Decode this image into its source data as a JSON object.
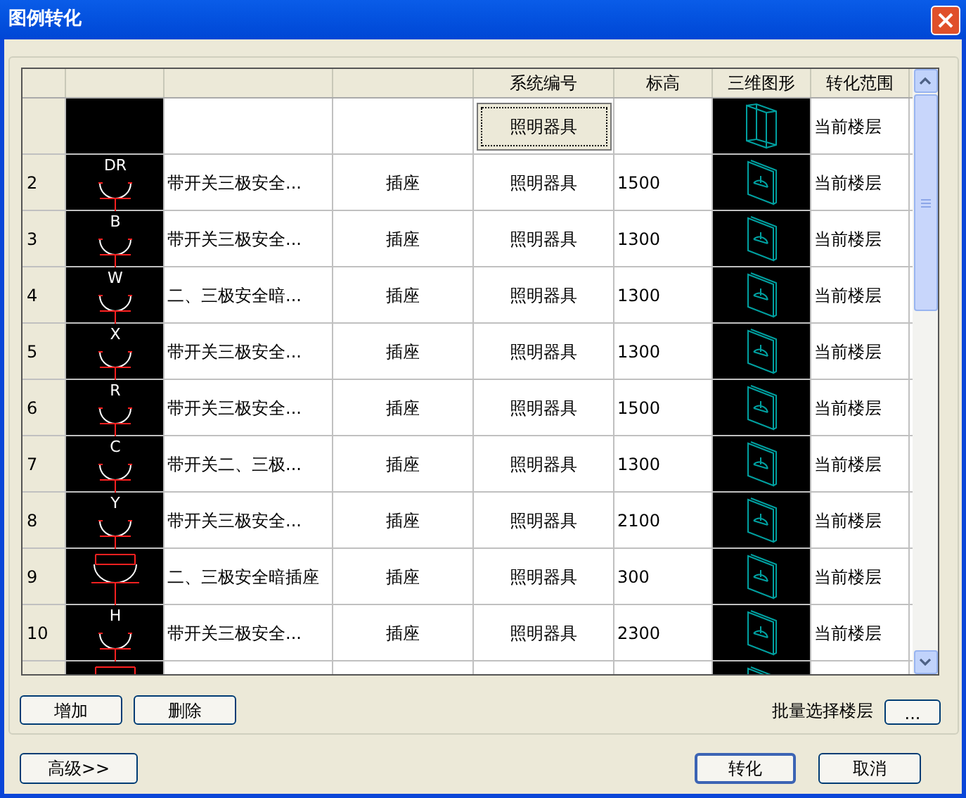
{
  "window": {
    "title": "图例转化"
  },
  "table": {
    "columns": [
      "系统编号",
      "标高",
      "三维图形",
      "转化范围"
    ],
    "rows": [
      {
        "editing": true,
        "symbol": {
          "kind": "none"
        },
        "system": "照明器具",
        "model": {
          "kind": "box"
        },
        "range": "当前楼层"
      },
      {
        "editing": false,
        "number": "2",
        "symbol": {
          "kind": "arc",
          "letter": "DR"
        },
        "name": "带开关三极安全...",
        "type": "插座",
        "system": "照明器具",
        "elevation": "1500",
        "model": {
          "kind": "plate"
        },
        "range": "当前楼层"
      },
      {
        "editing": false,
        "number": "3",
        "symbol": {
          "kind": "arc",
          "letter": "B"
        },
        "name": "带开关三极安全...",
        "type": "插座",
        "system": "照明器具",
        "elevation": "1300",
        "model": {
          "kind": "plate"
        },
        "range": "当前楼层"
      },
      {
        "editing": false,
        "number": "4",
        "symbol": {
          "kind": "arc",
          "letter": "W"
        },
        "name": "二、三极安全暗...",
        "type": "插座",
        "system": "照明器具",
        "elevation": "1300",
        "model": {
          "kind": "plate"
        },
        "range": "当前楼层"
      },
      {
        "editing": false,
        "number": "5",
        "symbol": {
          "kind": "arc",
          "letter": "X"
        },
        "name": "带开关三极安全...",
        "type": "插座",
        "system": "照明器具",
        "elevation": "1300",
        "model": {
          "kind": "plate"
        },
        "range": "当前楼层"
      },
      {
        "editing": false,
        "number": "6",
        "symbol": {
          "kind": "arc",
          "letter": "R"
        },
        "name": "带开关三极安全...",
        "type": "插座",
        "system": "照明器具",
        "elevation": "1500",
        "model": {
          "kind": "plate"
        },
        "range": "当前楼层"
      },
      {
        "editing": false,
        "number": "7",
        "symbol": {
          "kind": "arc",
          "letter": "C"
        },
        "name": "带开关二、三极...",
        "type": "插座",
        "system": "照明器具",
        "elevation": "1300",
        "model": {
          "kind": "plate"
        },
        "range": "当前楼层"
      },
      {
        "editing": false,
        "number": "8",
        "symbol": {
          "kind": "arc",
          "letter": "Y"
        },
        "name": "带开关三极安全...",
        "type": "插座",
        "system": "照明器具",
        "elevation": "2100",
        "model": {
          "kind": "plate"
        },
        "range": "当前楼层"
      },
      {
        "editing": false,
        "number": "9",
        "symbol": {
          "kind": "bar"
        },
        "name": "二、三极安全暗插座",
        "type": "插座",
        "system": "照明器具",
        "elevation": "300",
        "model": {
          "kind": "plate"
        },
        "range": "当前楼层"
      },
      {
        "editing": false,
        "number": "10",
        "symbol": {
          "kind": "arc",
          "letter": "H"
        },
        "name": "带开关三极安全...",
        "type": "插座",
        "system": "照明器具",
        "elevation": "2300",
        "model": {
          "kind": "plate"
        },
        "range": "当前楼层"
      },
      {
        "editing": false,
        "symbol": {
          "kind": "bar"
        },
        "model": {
          "kind": "plate"
        }
      }
    ]
  },
  "buttons": {
    "add": "增加",
    "delete": "删除",
    "batch_label": "批量选择楼层",
    "batch": "...",
    "advanced": "高级>>",
    "convert": "转化",
    "cancel": "取消"
  }
}
